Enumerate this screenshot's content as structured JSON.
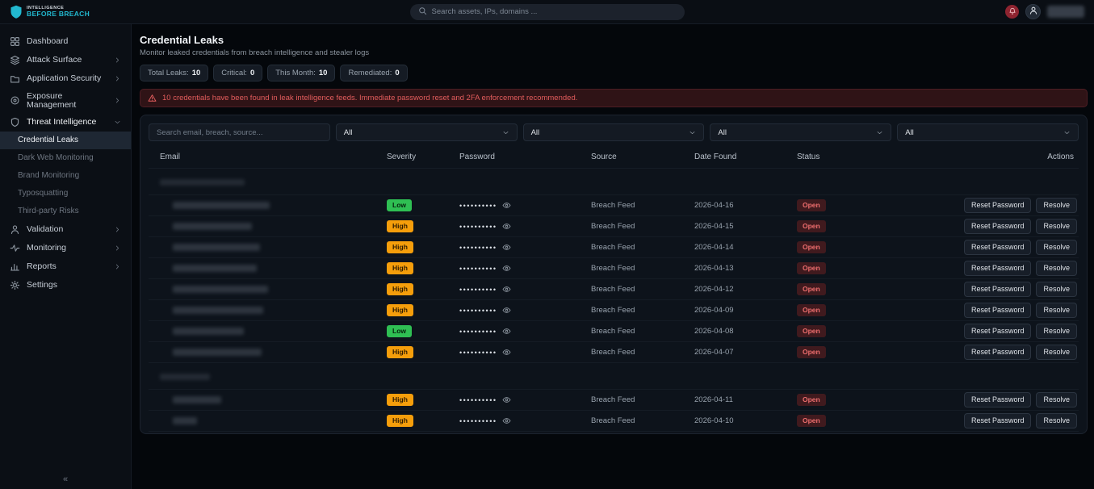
{
  "topbar": {
    "logo_line1": "INTELLIGENCE",
    "logo_line2": "BEFORE BREACH",
    "search_placeholder": "Search assets, IPs, domains ..."
  },
  "sidebar": {
    "items": [
      {
        "label": "Dashboard",
        "icon": "dashboard-icon"
      },
      {
        "label": "Attack Surface",
        "icon": "attack-surface-icon",
        "chevron": "right"
      },
      {
        "label": "Application Security",
        "icon": "app-security-icon",
        "chevron": "right"
      },
      {
        "label": "Exposure Management",
        "icon": "exposure-icon",
        "chevron": "right"
      },
      {
        "label": "Threat Intelligence",
        "icon": "threat-intel-icon",
        "chevron": "down",
        "active": true,
        "sub": [
          {
            "label": "Credential Leaks",
            "active": true
          },
          {
            "label": "Dark Web Monitoring"
          },
          {
            "label": "Brand Monitoring"
          },
          {
            "label": "Typosquatting"
          },
          {
            "label": "Third-party Risks"
          }
        ]
      },
      {
        "label": "Validation",
        "icon": "validation-icon",
        "chevron": "right"
      },
      {
        "label": "Monitoring",
        "icon": "monitoring-icon",
        "chevron": "right"
      },
      {
        "label": "Reports",
        "icon": "reports-icon",
        "chevron": "right"
      },
      {
        "label": "Settings",
        "icon": "settings-icon"
      }
    ],
    "collapse_glyph": "«"
  },
  "page": {
    "title": "Credential Leaks",
    "subtitle": "Monitor leaked credentials from breach intelligence and stealer logs",
    "stats": [
      {
        "label": "Total Leaks:",
        "value": "10"
      },
      {
        "label": "Critical:",
        "value": "0"
      },
      {
        "label": "This Month:",
        "value": "10"
      },
      {
        "label": "Remediated:",
        "value": "0"
      }
    ],
    "alert_text": "10 credentials have been found in leak intelligence feeds. Immediate password reset and 2FA enforcement recommended."
  },
  "filters": {
    "search_placeholder": "Search email, breach, source...",
    "dropdowns": [
      {
        "value": "All"
      },
      {
        "value": "All"
      },
      {
        "value": "All"
      },
      {
        "value": "All"
      }
    ]
  },
  "table": {
    "columns": [
      "Email",
      "Severity",
      "Password",
      "Source",
      "Date Found",
      "Status",
      "Actions"
    ],
    "action_labels": {
      "reset": "Reset Password",
      "resolve": "Resolve"
    },
    "groups": [
      {
        "redacted_label_width": 105,
        "rows": [
          {
            "severity": "Low",
            "password": "••••••••••",
            "source": "Breach Feed",
            "date": "2026-04-16",
            "status": "Open",
            "redacted_email_width": 120
          },
          {
            "severity": "High",
            "password": "••••••••••",
            "source": "Breach Feed",
            "date": "2026-04-15",
            "status": "Open",
            "redacted_email_width": 98
          },
          {
            "severity": "High",
            "password": "••••••••••",
            "source": "Breach Feed",
            "date": "2026-04-14",
            "status": "Open",
            "redacted_email_width": 108
          },
          {
            "severity": "High",
            "password": "••••••••••",
            "source": "Breach Feed",
            "date": "2026-04-13",
            "status": "Open",
            "redacted_email_width": 104
          },
          {
            "severity": "High",
            "password": "••••••••••",
            "source": "Breach Feed",
            "date": "2026-04-12",
            "status": "Open",
            "redacted_email_width": 118
          },
          {
            "severity": "High",
            "password": "••••••••••",
            "source": "Breach Feed",
            "date": "2026-04-09",
            "status": "Open",
            "redacted_email_width": 112
          },
          {
            "severity": "Low",
            "password": "••••••••••",
            "source": "Breach Feed",
            "date": "2026-04-08",
            "status": "Open",
            "redacted_email_width": 88
          },
          {
            "severity": "High",
            "password": "••••••••••",
            "source": "Breach Feed",
            "date": "2026-04-07",
            "status": "Open",
            "redacted_email_width": 110
          }
        ]
      },
      {
        "redacted_label_width": 62,
        "rows": [
          {
            "severity": "High",
            "password": "••••••••••",
            "source": "Breach Feed",
            "date": "2026-04-11",
            "status": "Open",
            "redacted_email_width": 60
          },
          {
            "severity": "High",
            "password": "••••••••••",
            "source": "Breach Feed",
            "date": "2026-04-10",
            "status": "Open",
            "redacted_email_width": 30
          }
        ]
      }
    ]
  },
  "colors": {
    "accent": "#22b8cf",
    "severity_low": "#2fbf53",
    "severity_high": "#f59e0b",
    "status_open": "#ee6e6e",
    "alert": "#e35d5d"
  }
}
